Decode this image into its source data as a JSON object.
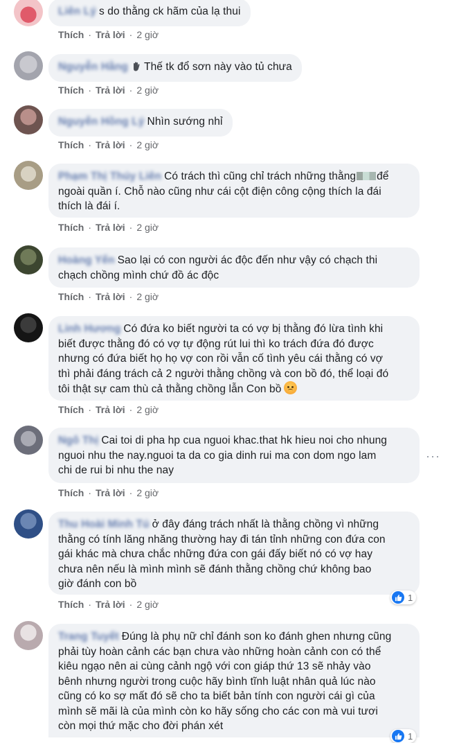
{
  "actions": {
    "like": "Thích",
    "reply": "Trả lời",
    "sep": "·"
  },
  "comments": [
    {
      "name": "Liên Lý",
      "text": "s do thằng ck hãm của lạ thui",
      "time": "2 giờ"
    },
    {
      "name": "Nguyễn Hằng",
      "icon": "waving-hand-icon",
      "text": "Thế tk đổ sơn này vào tủ chưa",
      "time": "2 giờ"
    },
    {
      "name": "Nguyễn Hồng Lý",
      "text": "Nhìn sướng nhỉ",
      "time": "2 giờ"
    },
    {
      "name": "Phạm Thị Thúy Liên",
      "text_a": "Có trách thì cũng chỉ trách những thằng",
      "text_b": "để",
      "text_c": "ngoài quần í. Chỗ nào cũng như cái cột điện công cộng thích la đái",
      "text_d": "thích là đái í.",
      "time": "2 giờ"
    },
    {
      "name": "Hoàng Yến",
      "text_a": "Sao lại có con người ác độc đến như vậy có chạch thi",
      "text_b": "chạch chồng mình chứ đồ ác độc",
      "time": "2 giờ"
    },
    {
      "name": "Linh Hương",
      "text_a": "Có đứa ko biết người ta có vợ bị thằng đó lừa tình khi",
      "text_b": "biết được thằng đó có vợ tự động rút lui thì ko trách đứa đó được",
      "text_c": "nhưng có đứa biết họ họ vợ con rồi vẫn cố tình yêu cái thằng có vợ",
      "text_d": "thì phải đáng trách cả 2 người thằng chồng và con bồ đó, thể loại đó",
      "text_e": "tôi thật sự cam thù cả thằng chồng lẫn Con bồ",
      "emoji": "angry-face-icon",
      "time": "2 giờ"
    },
    {
      "name": "Ngô Thị",
      "text_a": "Cai toi di pha hp cua nguoi khac.that hk hieu noi cho nhung",
      "text_b": "nguoi nhu the nay.nguoi ta da co gia dinh rui ma con dom ngo lam",
      "text_c": "chi de rui bi nhu the nay",
      "time": "2 giờ",
      "more": "···"
    },
    {
      "name": "Thu Hoài Minh Tú",
      "text_a": "ở đây đáng trách nhất là thằng chồng vì những",
      "text_b": "thằng có tính lăng nhăng thường hay đi tán tỉnh những con đứa con",
      "text_c": "gái khác mà chưa chắc những đứa con gái đấy biết nó có vợ hay",
      "text_d": "chưa nên nếu là mình mình sẽ đánh thằng chồng chứ không bao",
      "text_e": "giờ đánh con bồ",
      "time": "2 giờ",
      "reactions": "1"
    },
    {
      "name": "Trang Tuyết",
      "text_a": "Đúng là phụ nữ chỉ đánh son ko đánh ghen nhưng cũng",
      "text_b": "phải tùy hoàn cảnh các bạn chưa vào những hoàn cảnh con có thể",
      "text_c": "kiêu ngạo nên ai cùng cảnh ngộ với con giáp thứ 13 sẽ nhảy vào",
      "text_d": "bênh nhưng người trong cuộc hãy bình tĩnh luật nhân quả lúc nào",
      "text_e": "cũng có ko sợ mất đó sẽ cho ta biết bản tính con người cái gì của",
      "text_f": "mình sẽ mãi là của mình còn ko hãy sống cho các con mà vui tươi",
      "text_g": "còn mọi thứ mặc cho đời phán xét",
      "reactions": "1"
    }
  ]
}
